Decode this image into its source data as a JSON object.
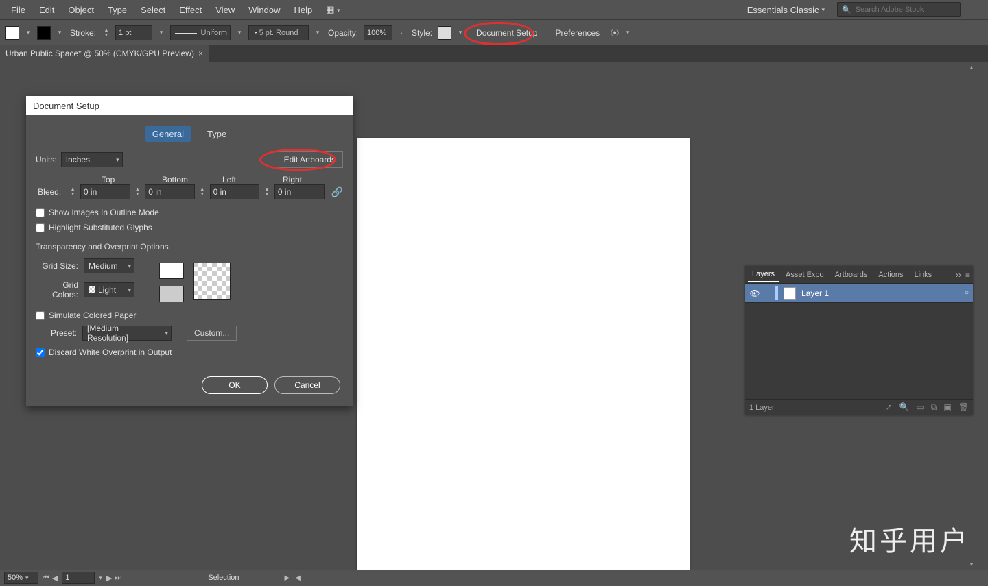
{
  "menu": {
    "items": [
      "File",
      "Edit",
      "Object",
      "Type",
      "Select",
      "Effect",
      "View",
      "Window",
      "Help"
    ],
    "workspace": "Essentials Classic",
    "search_placeholder": "Search Adobe Stock"
  },
  "control": {
    "stroke_label": "Stroke:",
    "stroke_value": "1 pt",
    "stroke_style": "Uniform",
    "brush": "5 pt. Round",
    "opacity_label": "Opacity:",
    "opacity_value": "100%",
    "style_label": "Style:",
    "doc_setup": "Document Setup",
    "preferences": "Preferences"
  },
  "tab": {
    "title": "Urban Public Space* @ 50% (CMYK/GPU Preview)"
  },
  "dialog": {
    "title": "Document Setup",
    "tab_general": "General",
    "tab_type": "Type",
    "units_label": "Units:",
    "units_value": "Inches",
    "edit_artboards": "Edit Artboards",
    "bleed_label": "Bleed:",
    "bleed_headers": {
      "top": "Top",
      "bottom": "Bottom",
      "left": "Left",
      "right": "Right"
    },
    "bleed_values": {
      "top": "0 in",
      "bottom": "0 in",
      "left": "0 in",
      "right": "0 in"
    },
    "show_images_outline": "Show Images In Outline Mode",
    "highlight_glyphs": "Highlight Substituted Glyphs",
    "section_transparency": "Transparency and Overprint Options",
    "grid_size_label": "Grid Size:",
    "grid_size_value": "Medium",
    "grid_colors_label": "Grid Colors:",
    "grid_colors_value": "Light",
    "simulate_paper": "Simulate Colored Paper",
    "preset_label": "Preset:",
    "preset_value": "[Medium Resolution]",
    "custom": "Custom...",
    "discard_overprint": "Discard White Overprint in Output",
    "ok": "OK",
    "cancel": "Cancel"
  },
  "layers": {
    "tabs": [
      "Layers",
      "Asset Expo",
      "Artboards",
      "Actions",
      "Links"
    ],
    "layer_name": "Layer 1",
    "footer": "1 Layer"
  },
  "status": {
    "zoom": "50%",
    "artboard": "1",
    "tool": "Selection"
  },
  "watermark": "知乎用户"
}
